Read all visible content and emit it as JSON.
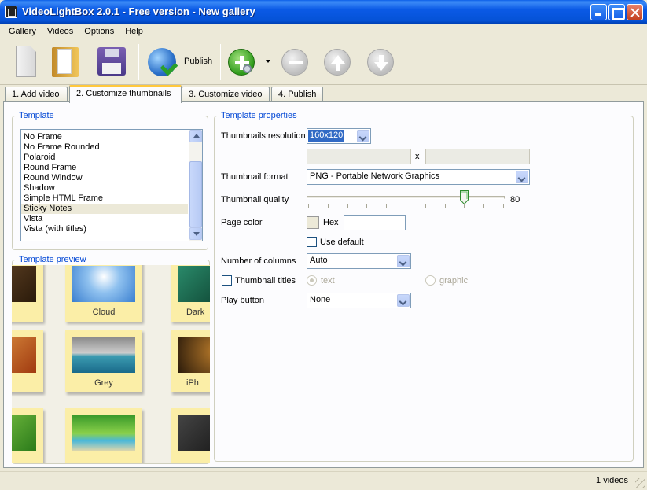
{
  "window": {
    "title": "VideoLightBox 2.0.1 - Free version - New gallery"
  },
  "menu": [
    "Gallery",
    "Videos",
    "Options",
    "Help"
  ],
  "toolbar": {
    "publish_label": "Publish"
  },
  "tabs": [
    "1. Add video",
    "2. Customize thumbnails",
    "3. Customize video",
    "4. Publish"
  ],
  "template": {
    "legend": "Template",
    "items": [
      "No Frame",
      "No Frame Rounded",
      "Polaroid",
      "Round Frame",
      "Round Window",
      "Shadow",
      "Simple HTML Frame",
      "Sticky Notes",
      "Vista",
      "Vista (with titles)"
    ],
    "selected_index": 7
  },
  "preview": {
    "legend": "Template preview",
    "captions": [
      "Cloud",
      "Dark",
      "Grey",
      "iPh"
    ]
  },
  "props": {
    "legend": "Template properties",
    "resolution": {
      "label": "Thumbnails resolution",
      "value": "160x120",
      "x": "x"
    },
    "format": {
      "label": "Thumbnail format",
      "value": "PNG - Portable Network Graphics"
    },
    "quality": {
      "label": "Thumbnail quality",
      "value": "80",
      "level": 0.8
    },
    "page_color": {
      "label": "Page color",
      "hex_label": "Hex",
      "use_default": "Use default"
    },
    "columns": {
      "label": "Number of columns",
      "value": "Auto"
    },
    "titles": {
      "label": "Thumbnail titles",
      "text_opt": "text",
      "graphic_opt": "graphic"
    },
    "play_button": {
      "label": "Play button",
      "value": "None"
    }
  },
  "status": {
    "count": "1 videos"
  },
  "colors": {
    "accent": "#0046d5",
    "selection": "#316ac5",
    "titlebar": "#0552d6"
  }
}
